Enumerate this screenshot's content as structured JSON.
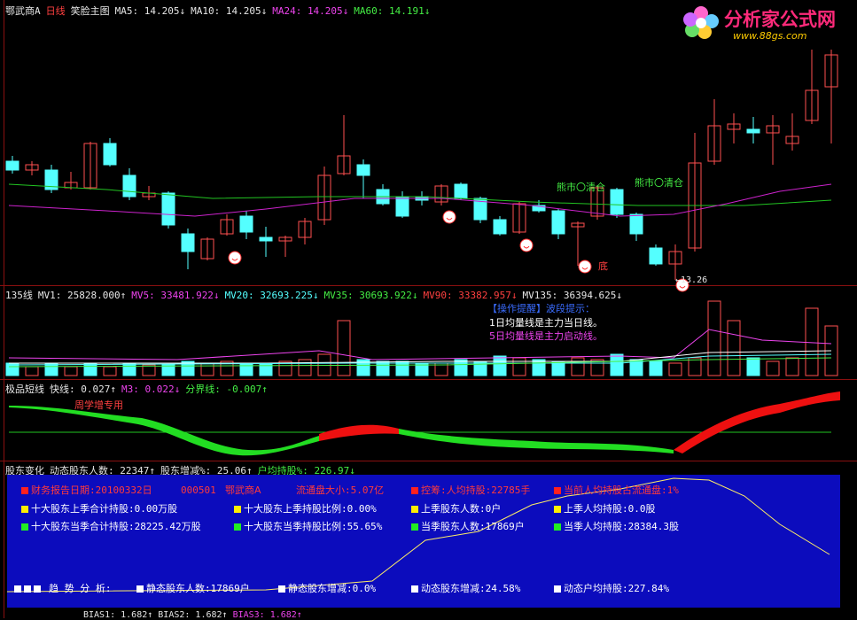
{
  "main_header": {
    "stock": "鄂武商A",
    "period": "日线",
    "indicator": "笑脸主图",
    "ma5": "MA5: 14.205↓",
    "ma10": "MA10: 14.205↓",
    "ma24": "MA24: 14.205↓",
    "ma60": "MA60: 14.191↓"
  },
  "logo": {
    "text": "分析家公式网",
    "url": "www.88gs.com"
  },
  "main_chart": {
    "annotations": [
      "熊市〇清仓",
      "熊市〇清仓",
      "底",
      "←13.26"
    ]
  },
  "volume_header": {
    "name": "135线",
    "mv1": "MV1: 25828.000↑",
    "mv5": "MV5: 33481.922↓",
    "mv20": "MV20: 32693.225↓",
    "mv35": "MV35: 30693.922↓",
    "mv90": "MV90: 33382.957↓",
    "mv135": "MV135: 36394.625↓"
  },
  "volume_notes": {
    "title": "【操作提醒】波段提示：",
    "line1": "1日均量线是主力当日线。",
    "line2": "5日均量线是主力启动线。"
  },
  "short_header": {
    "name": "极品短线",
    "fast": "快线: 0.027↑",
    "m3": "M3: 0.022↓",
    "divider": "分界线: -0.007↑",
    "note": "周学增专用"
  },
  "holders_header": {
    "name": "股东变化",
    "dynamic": "动态股东人数: 22347↑",
    "change": "股东增减%: 25.06↑",
    "per_holder": "户均持股%: 226.97↓"
  },
  "info_panel": {
    "row1": [
      "财务报告日期:20100332日",
      "000501",
      "鄂武商A",
      "流通盘大小:5.07亿",
      "控筹:人均持股:22785手",
      "当前人均持股占流通盘:1%"
    ],
    "row2": [
      "十大股东上季合计持股:0.00万股",
      "十大股东上季持股比例:0.00%",
      "上季股东人数:0户",
      "上季人均持股:0.0股"
    ],
    "row3": [
      "十大股东当季合计持股:28225.42万股",
      "十大股东当季持股比例:55.65%",
      "当季股东人数:17869户",
      "当季人均持股:28384.3股"
    ],
    "row4": [
      "趋 势 分 析:",
      "静态股东人数:17869户",
      "静态股东增减:0.0%",
      "动态股东增减:24.58%",
      "动态户均持股:227.84%"
    ]
  },
  "bias_footer": {
    "bias1": "BIAS1: 1.682↑",
    "bias2": "BIAS2: 1.682↑",
    "bias3": "BIAS3: 1.682↑"
  },
  "colors": {
    "up": "#ff5050",
    "down": "#54ffff",
    "ma_green": "#22c422",
    "ma_magenta": "#cc22cc",
    "panel_blue": "#0c0cbd",
    "grid": "#8a1010"
  }
}
